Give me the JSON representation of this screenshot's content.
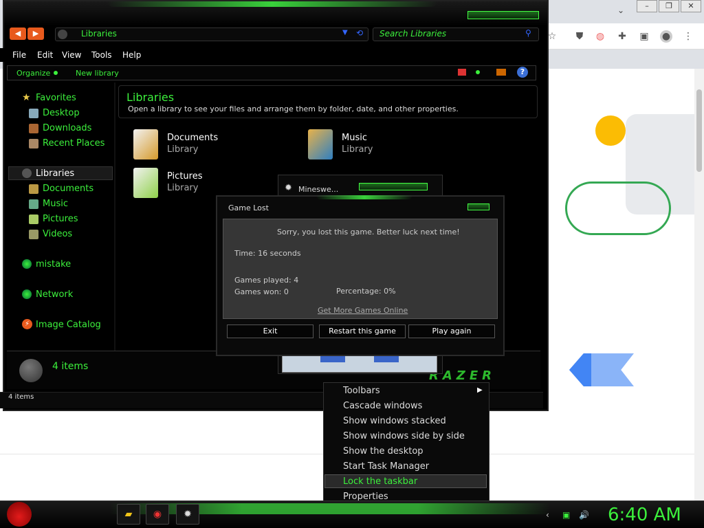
{
  "explorer": {
    "address": "Libraries",
    "search_placeholder": "Search Libraries",
    "menu": [
      "File",
      "Edit",
      "View",
      "Tools",
      "Help"
    ],
    "commands": {
      "organize": "Organize",
      "new_library": "New library"
    },
    "nav": {
      "favorites": "Favorites",
      "desktop": "Desktop",
      "downloads": "Downloads",
      "recent": "Recent Places",
      "libraries": "Libraries",
      "documents": "Documents",
      "music": "Music",
      "pictures": "Pictures",
      "videos": "Videos",
      "mistake": "mistake",
      "network": "Network",
      "image_catalog": "Image Catalog"
    },
    "content": {
      "title": "Libraries",
      "description": "Open a library to see your files and arrange them by folder, date, and other properties.",
      "items": [
        {
          "name": "Documents",
          "sub": "Library"
        },
        {
          "name": "Music",
          "sub": "Library"
        },
        {
          "name": "Pictures",
          "sub": "Library"
        }
      ]
    },
    "details_count": "4 items",
    "status": "4 items",
    "brand": "RAZER"
  },
  "minesweeper": {
    "title": "Mineswe..."
  },
  "dialog": {
    "title": "Game Lost",
    "message": "Sorry, you lost this game. Better luck next time!",
    "time": "Time: 16 seconds",
    "played": "Games played: 4",
    "won": "Games won: 0",
    "percentage": "Percentage: 0%",
    "link": "Get More Games Online",
    "buttons": {
      "exit": "Exit",
      "restart": "Restart this game",
      "again": "Play again"
    }
  },
  "context_menu": {
    "items": [
      "Toolbars",
      "Cascade windows",
      "Show windows stacked",
      "Show windows side by side",
      "Show the desktop",
      "Start Task Manager",
      "Lock the taskbar",
      "Properties"
    ],
    "selected": "Lock the taskbar"
  },
  "taskbar": {
    "clock": "6:40 AM"
  },
  "colors": {
    "accent": "#3cf03c",
    "chrome_bg": "#dee1e6",
    "google_yellow": "#fbbc04",
    "google_green": "#34a853",
    "google_blue": "#4285f4"
  }
}
